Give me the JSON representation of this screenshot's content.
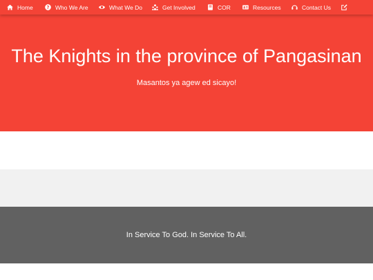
{
  "nav": {
    "items": [
      {
        "label": "Home",
        "icon": "home-icon"
      },
      {
        "label": "Who We Are",
        "icon": "question-circle-icon"
      },
      {
        "label": "What We Do",
        "icon": "eye-icon"
      },
      {
        "label": "Get Involved",
        "icon": "people-icon"
      },
      {
        "label": "COR",
        "icon": "book-icon"
      },
      {
        "label": "Resources",
        "icon": "id-card-icon"
      },
      {
        "label": "Contact Us",
        "icon": "headset-icon"
      },
      {
        "label": "",
        "icon": "edit-icon"
      }
    ]
  },
  "hero": {
    "title": "The Knights in the province of Pangasinan",
    "subtitle": "Masantos ya agew ed sicayo!"
  },
  "footer": {
    "motto": "In Service To God. In Service To All."
  },
  "colors": {
    "brand_red": "#f44336",
    "footer_gray": "#616161",
    "light_band": "#f1f1f1"
  }
}
